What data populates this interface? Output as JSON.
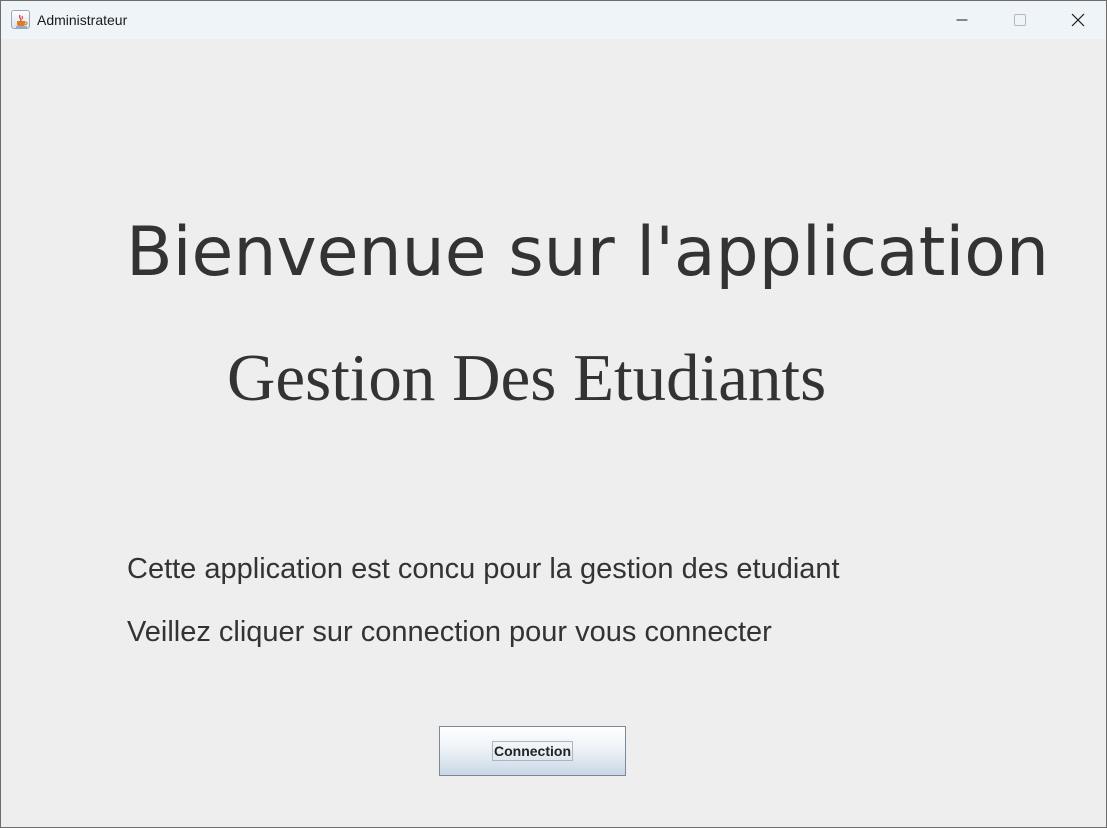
{
  "window": {
    "title": "Administrateur",
    "icon": "java-cup-icon",
    "controls": [
      "minimize-icon",
      "maximize-icon",
      "close-icon"
    ]
  },
  "main": {
    "heading": "Bienvenue sur l'application",
    "subheading": "Gestion Des Etudiants",
    "description_line1": "Cette application est concu pour la gestion des etudiant",
    "description_line2": "Veillez cliquer sur connection pour vous connecter",
    "connect_button_label": "Connection"
  },
  "colors": {
    "background": "#eeeeee",
    "titlebar": "#eff4f9",
    "text": "#333333"
  }
}
